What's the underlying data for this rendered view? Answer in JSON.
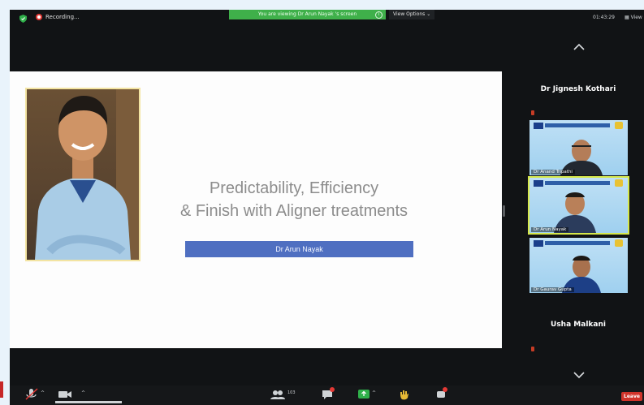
{
  "top_bar": {
    "recording_label": "Recording...",
    "viewing_banner": "You are viewing Dr Arun Nayak     's screen",
    "view_options": "View Options ⌄",
    "clock": "01:43:29",
    "view_button": "View"
  },
  "slide": {
    "title_line1": "Predictability, Efficiency",
    "title_line2": "& Finish with Aligner treatments",
    "presenter_name": "Dr Arun Nayak"
  },
  "gallery": {
    "top_name": "Dr Jignesh Kothari",
    "tiles": [
      {
        "caption": "Dr Anand Tripathi"
      },
      {
        "caption": "Dr Arun Nayak"
      },
      {
        "caption": "Dr Gaurav Gupta"
      }
    ],
    "bottom_name": "Usha Malkani"
  },
  "toolbar": {
    "participants_count": "103",
    "leave_label": "Leave"
  },
  "colors": {
    "banner_green": "#3fb04a",
    "name_bar_blue": "#4f6fc1",
    "leave_red": "#d0332a",
    "active_speaker_outline": "#d6e84a"
  }
}
